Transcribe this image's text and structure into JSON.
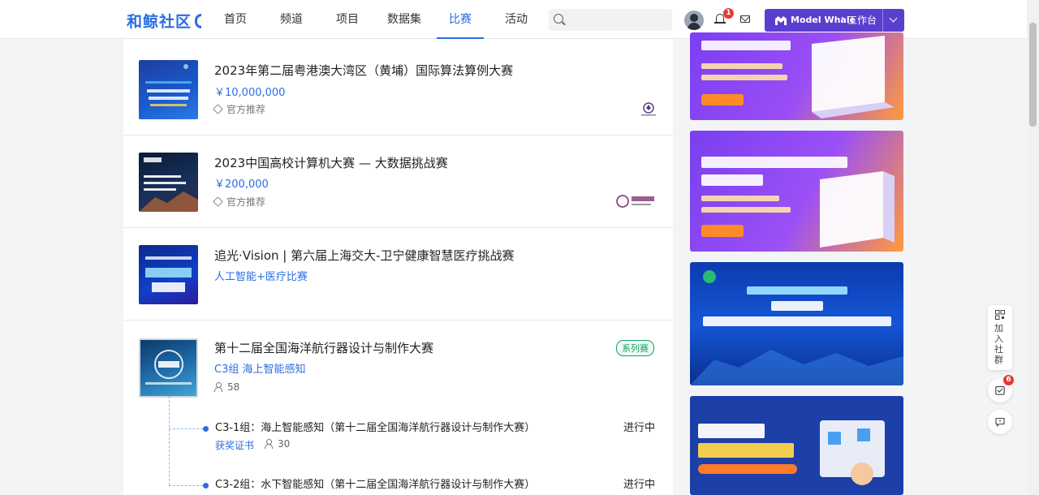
{
  "header": {
    "logo": "和鲸社区",
    "nav": [
      {
        "label": "首页"
      },
      {
        "label": "频道"
      },
      {
        "label": "项目"
      },
      {
        "label": "数据集"
      },
      {
        "label": "比赛",
        "active": true
      },
      {
        "label": "活动"
      }
    ],
    "search": {
      "placeholder": "",
      "value": ""
    },
    "notification_count": "1",
    "workspace": {
      "brand": "Model Whale",
      "separator": "·",
      "label": "工作台"
    }
  },
  "competitions": [
    {
      "title": "2023年第二届粤港澳大湾区（黄埔）国际算法算例大赛",
      "prize": "￥10,000,000",
      "tag": "官方推荐"
    },
    {
      "title": "2023中国高校计算机大赛 — 大数据挑战赛",
      "prize": "￥200,000",
      "tag": "官方推荐"
    },
    {
      "title": "追光·Vision | 第六届上海交大-卫宁健康智慧医疗挑战赛",
      "category": "人工智能+医疗比赛"
    },
    {
      "title": "第十二届全国海洋航行器设计与制作大赛",
      "category": "C3组 海上智能感知",
      "participants": "58",
      "series_badge": "系列赛",
      "sub_items": [
        {
          "title": "C3-1组：海上智能感知（第十二届全国海洋航行器设计与制作大赛）",
          "status": "进行中",
          "cert": "获奖证书",
          "participants": "30"
        },
        {
          "title": "C3-2组：水下智能感知（第十二届全国海洋航行器设计与制作大赛）",
          "status": "进行中"
        }
      ]
    }
  ],
  "floatbar": {
    "join_group": "加入社群",
    "todo_count": "6"
  },
  "colors": {
    "accent": "#2b6de0",
    "workspace_button": "#5a3fcf",
    "badge": "#e53935",
    "series_green": "#17a061"
  }
}
